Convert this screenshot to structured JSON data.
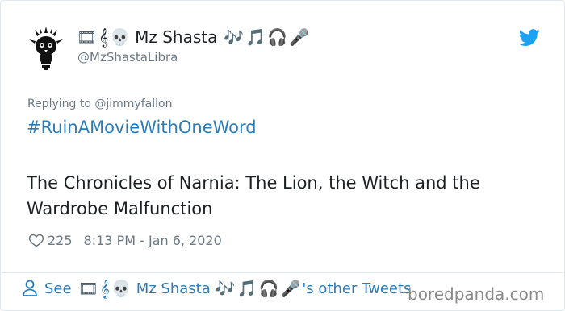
{
  "tweet": {
    "display_name": "Mz Shasta",
    "name_prefix_icons": [
      "film-frames-icon",
      "treble-clef-icon",
      "skull-icon"
    ],
    "name_suffix_icons": [
      "music-notes-icon",
      "musical-note-icon",
      "headphones-icon",
      "microphone-icon"
    ],
    "emoji": {
      "film": "🎞",
      "clef": "𝄞",
      "skull": "💀",
      "notes": "🎶",
      "note": "🎵",
      "headphones": "🎧",
      "mic": "🎤"
    },
    "handle": "@MzShastaLibra",
    "replying_to": "Replying to @jimmyfallon",
    "hashtag": "#RuinAMovieWithOneWord",
    "text": "The Chronicles of Narnia: The Lion, the Witch and the Wardrobe Malfunction",
    "like_count": "225",
    "timestamp": "8:13 PM - Jan 6, 2020"
  },
  "footer": {
    "see_label": "See",
    "name": "Mz Shasta",
    "suffix": "'s other Tweets"
  },
  "watermark": "boredpanda.com",
  "colors": {
    "link_blue": "#2b7bb9",
    "twitter_blue": "#1da1f2",
    "muted_gray": "#697882",
    "text_dark": "#1c2022",
    "border": "#e1e8ed"
  }
}
